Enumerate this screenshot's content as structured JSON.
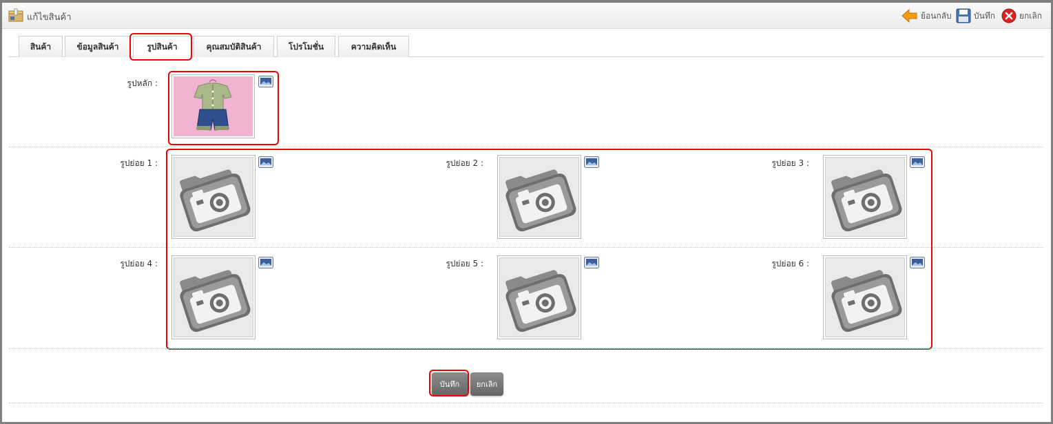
{
  "header": {
    "title": "แก้ไขสินค้า",
    "back_label": "ย้อนกลับ",
    "save_label": "บันทึก",
    "cancel_label": "ยกเลิก"
  },
  "tabs": [
    {
      "label": "สินค้า"
    },
    {
      "label": "ข้อมูลสินค้า"
    },
    {
      "label": "รูปสินค้า",
      "active": true
    },
    {
      "label": "คุณสมบัติสินค้า"
    },
    {
      "label": "โปรโมชั่น"
    },
    {
      "label": "ความคิดเห็น"
    }
  ],
  "images": {
    "main_label": "รูปหลัก :",
    "sub_labels": [
      "รูปย่อย 1 :",
      "รูปย่อย 2 :",
      "รูปย่อย 3 :",
      "รูปย่อย 4 :",
      "รูปย่อย 5 :",
      "รูปย่อย 6 :"
    ]
  },
  "form": {
    "save_label": "บันทึก",
    "cancel_label": "ยกเลิก"
  },
  "icons": {
    "back": "arrow-left-icon",
    "save": "floppy-disk-icon",
    "cancel": "close-circle-icon",
    "browse": "image-browse-icon",
    "placeholder": "camera-folder-icon"
  },
  "colors": {
    "highlight": "#e00000",
    "back_arrow": "#f39c12",
    "cancel_red": "#d9231d",
    "button_gray": "#777777"
  }
}
